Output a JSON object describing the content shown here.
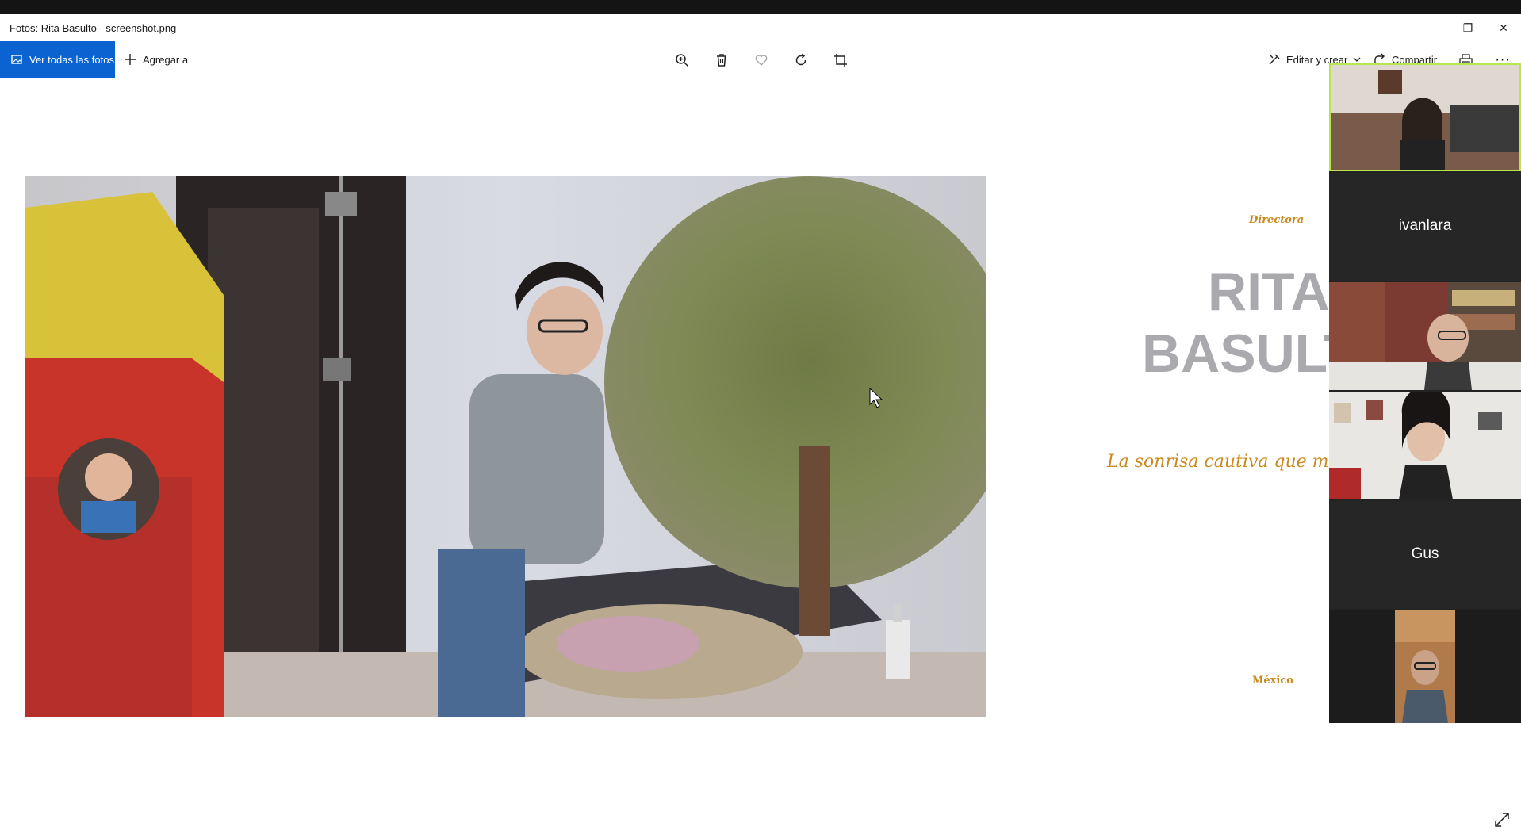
{
  "window": {
    "title": "Fotos: Rita Basulto - screenshot.png",
    "minimize": "—",
    "restore": "❐",
    "close": "✕"
  },
  "toolbar": {
    "view_all": "Ver todas las fotos",
    "add_to": "Agregar a",
    "edit_create": "Editar y crear",
    "share": "Compartir",
    "more": "···"
  },
  "slide": {
    "role": "Directora",
    "name_line1": "RITA",
    "name_line2": "BASULT",
    "tagline": "La sonrisa cautiva que mue",
    "country": "México"
  },
  "participants": [
    {
      "name": "",
      "video": true
    },
    {
      "name": "ivanlara",
      "video": false
    },
    {
      "name": "",
      "video": true
    },
    {
      "name": "",
      "video": true
    },
    {
      "name": "Gus",
      "video": false
    },
    {
      "name": "",
      "video": true
    }
  ],
  "colors": {
    "accent": "#0a63d1",
    "slide_gold": "#c98a1e",
    "name_gray": "#a9a9ae",
    "gallery_bg": "#232323",
    "active_speaker": "#b7e64a"
  },
  "icons": [
    "photos-icon",
    "plus-icon",
    "zoom-in-icon",
    "trash-icon",
    "heart-icon",
    "rotate-icon",
    "crop-icon",
    "edit-icon",
    "share-icon",
    "print-icon",
    "more-icon",
    "expand-icon"
  ]
}
